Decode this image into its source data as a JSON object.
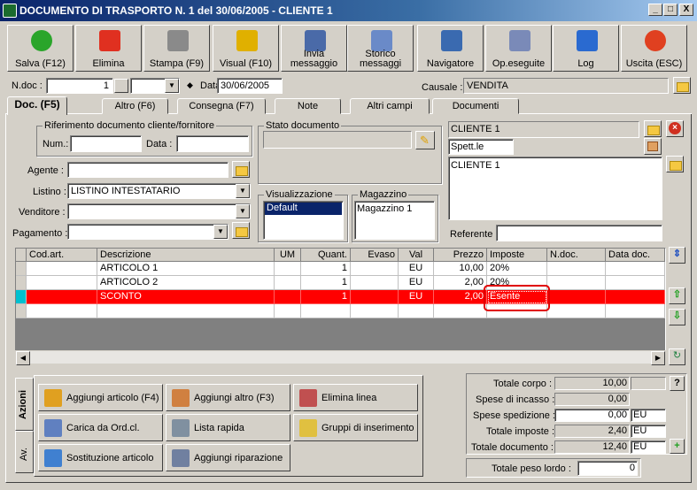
{
  "window": {
    "title": "DOCUMENTO DI TRASPORTO N. 1  del 30/06/2005 - CLIENTE 1",
    "min": "_",
    "max": "□",
    "close": "X"
  },
  "toolbar": [
    {
      "label": "Salva (F12)",
      "icon": "check-icon",
      "color": "#2aa52a"
    },
    {
      "label": "Elimina",
      "icon": "x-icon",
      "color": "#e03020"
    },
    {
      "label": "Stampa (F9)",
      "icon": "printer-icon",
      "color": "#8a8a8a"
    },
    {
      "label": "Visual (F10)",
      "icon": "magic-wand-icon",
      "color": "#e0b000"
    },
    {
      "label": "Invia\nmessaggio",
      "icon": "envelope-icon",
      "color": "#4a6aa8"
    },
    {
      "label": "Storico\nmessaggi",
      "icon": "envelope-search-icon",
      "color": "#6a8ac8"
    },
    {
      "label": "Navigatore",
      "icon": "compass-icon",
      "color": "#3a6ab0"
    },
    {
      "label": "Op.eseguite",
      "icon": "gears-icon",
      "color": "#7a8ab8"
    },
    {
      "label": "Log",
      "icon": "book-search-icon",
      "color": "#2a6ad0"
    },
    {
      "label": "Uscita (ESC)",
      "icon": "power-icon",
      "color": "#e04020"
    }
  ],
  "header": {
    "ndoc_label": "N.doc :",
    "ndoc_value": "1",
    "data_label": "Data :",
    "data_value": "30/06/2005",
    "causale_label": "Causale :",
    "causale_value": "VENDITA"
  },
  "tabs": [
    "Doc. (F5)",
    "Altro (F6)",
    "Consegna (F7)",
    "Note",
    "Altri campi",
    "Documenti"
  ],
  "riferimento": {
    "title": "Riferimento documento cliente/fornitore",
    "num_label": "Num.:",
    "data_label": "Data :"
  },
  "fields": {
    "agente": "Agente :",
    "listino": "Listino :",
    "listino_value": "LISTINO INTESTATARIO",
    "venditore": "Venditore :",
    "pagamento": "Pagamento :"
  },
  "stato": {
    "title": "Stato documento"
  },
  "visualizzazione": {
    "title": "Visualizzazione",
    "selected": "Default"
  },
  "magazzino": {
    "title": "Magazzino",
    "value": "Magazzino 1"
  },
  "cliente": {
    "name": "CLIENTE 1",
    "spett": "Spett.le",
    "address": "CLIENTE 1",
    "referente_label": "Referente"
  },
  "grid": {
    "headers": [
      "Cod.art.",
      "Descrizione",
      "UM",
      "Quant.",
      "Evaso",
      "Val",
      "Prezzo",
      "Imposte",
      "N.doc.",
      "Data doc."
    ],
    "rows": [
      {
        "cod": "",
        "desc": "ARTICOLO 1",
        "um": "",
        "qty": "1",
        "evaso": "",
        "val": "EU",
        "prezzo": "10,00",
        "imp": "20%",
        "ndoc": "",
        "data": ""
      },
      {
        "cod": "",
        "desc": "ARTICOLO 2",
        "um": "",
        "qty": "1",
        "evaso": "",
        "val": "EU",
        "prezzo": "2,00",
        "imp": "20%",
        "ndoc": "",
        "data": ""
      },
      {
        "cod": "",
        "desc": "SCONTO",
        "um": "",
        "qty": "1",
        "evaso": "",
        "val": "EU",
        "prezzo": "2,00",
        "imp": "Esente",
        "ndoc": "",
        "data": ""
      }
    ],
    "highlight_color": "#ff0000"
  },
  "actions": {
    "tab_azioni": "Azioni",
    "tab_av": "Av.",
    "buttons": [
      "Aggiungi articolo (F4)",
      "Aggiungi altro (F3)",
      "Elimina linea",
      "Carica da Ord.cl.",
      "Lista rapida",
      "Gruppi di inserimento",
      "Sostituzione articolo",
      "Aggiungi riparazione"
    ]
  },
  "totals": {
    "corpo_label": "Totale corpo :",
    "corpo": "10,00",
    "incasso_label": "Spese di incasso :",
    "incasso": "0,00",
    "spedizione_label": "Spese spedizione :",
    "spedizione": "0,00",
    "spedizione_cur": "EU",
    "imposte_label": "Totale imposte :",
    "imposte": "2,40",
    "imposte_cur": "EU",
    "documento_label": "Totale documento :",
    "documento": "12,40",
    "documento_cur": "EU",
    "peso_label": "Totale peso lordo :",
    "peso": "0",
    "help": "?"
  }
}
